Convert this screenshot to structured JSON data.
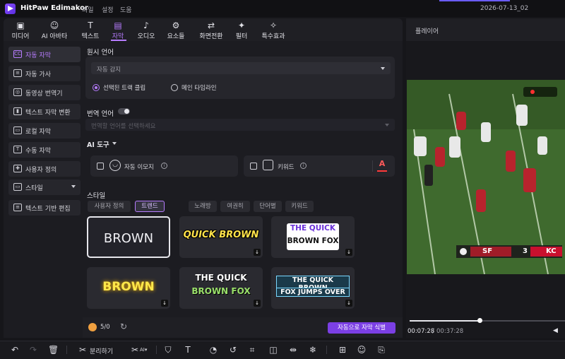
{
  "app": {
    "name": "HitPaw Edimakor",
    "project_title": "2026-07-13_02"
  },
  "menu": [
    "파일",
    "설정",
    "도움"
  ],
  "toolbar": [
    {
      "label": "미디어",
      "icon": "media-icon"
    },
    {
      "label": "AI 아바타",
      "icon": "avatar-icon"
    },
    {
      "label": "텍스트",
      "icon": "text-icon"
    },
    {
      "label": "자막",
      "icon": "subtitle-icon",
      "active": true
    },
    {
      "label": "오디오",
      "icon": "audio-icon"
    },
    {
      "label": "요소들",
      "icon": "elements-icon"
    },
    {
      "label": "화면전환",
      "icon": "transition-icon"
    },
    {
      "label": "필터",
      "icon": "filter-icon"
    },
    {
      "label": "특수효과",
      "icon": "effects-icon"
    }
  ],
  "sidebar": [
    {
      "label": "자동 자막",
      "active": true,
      "icon": "CC"
    },
    {
      "label": "자동 가사",
      "icon": "≡"
    },
    {
      "label": "동영상 번역기",
      "icon": "◎"
    },
    {
      "label": "텍스트 자막 변환",
      "icon": "▮"
    },
    {
      "label": "로컬 자막",
      "icon": "▭"
    },
    {
      "label": "수동 자막",
      "icon": "T"
    },
    {
      "label": "사용자 정의",
      "icon": "✚"
    },
    {
      "label": "스타일",
      "icon": "▭",
      "has_caret": true
    },
    {
      "label": "텍스트 기반 편집",
      "icon": "≡"
    }
  ],
  "source_lang": {
    "label": "원시 언어",
    "value": "자동 감지",
    "options": [
      "선택된 트랙 클립",
      "메인 타임라인"
    ],
    "selected": 0
  },
  "translation": {
    "label": "번역 언어",
    "placeholder": "번역할 언어를 선택하세요"
  },
  "ai_tools": {
    "label": "AI 도구",
    "emoji_label": "자동 이모지",
    "keyword_label": "키워드"
  },
  "style": {
    "label": "스타일",
    "tabs": [
      "사용자 정의",
      "트렌드",
      "노래방",
      "여권히",
      "단어별",
      "키워드"
    ],
    "active_tab": 1,
    "tiles": [
      {
        "text": "BROWN"
      },
      {
        "text": "QUICK BROWN"
      },
      {
        "line1": "THE QUICK",
        "line2": "BROWN FOX"
      },
      {
        "text": "BROWN"
      },
      {
        "line1": "THE QUICK",
        "line2": "BROWN FOX"
      },
      {
        "line1": "THE QUICK BROWN",
        "line2": "FOX JUMPS OVER"
      }
    ]
  },
  "credits": "5/0",
  "auto_subtitle_button": "자동으로 자막 식별",
  "player": {
    "title": "플레이어",
    "time_current": "00:07:28",
    "time_total": "00:37:28",
    "progress": 0.45,
    "scoreboard": {
      "team1": "SF",
      "score1": "3",
      "team2": "KC",
      "score2": "0"
    }
  },
  "bottom_tools": {
    "split_label": "분리하기"
  },
  "colors": {
    "accent": "#b77cff",
    "button": "#7b3fe4"
  }
}
